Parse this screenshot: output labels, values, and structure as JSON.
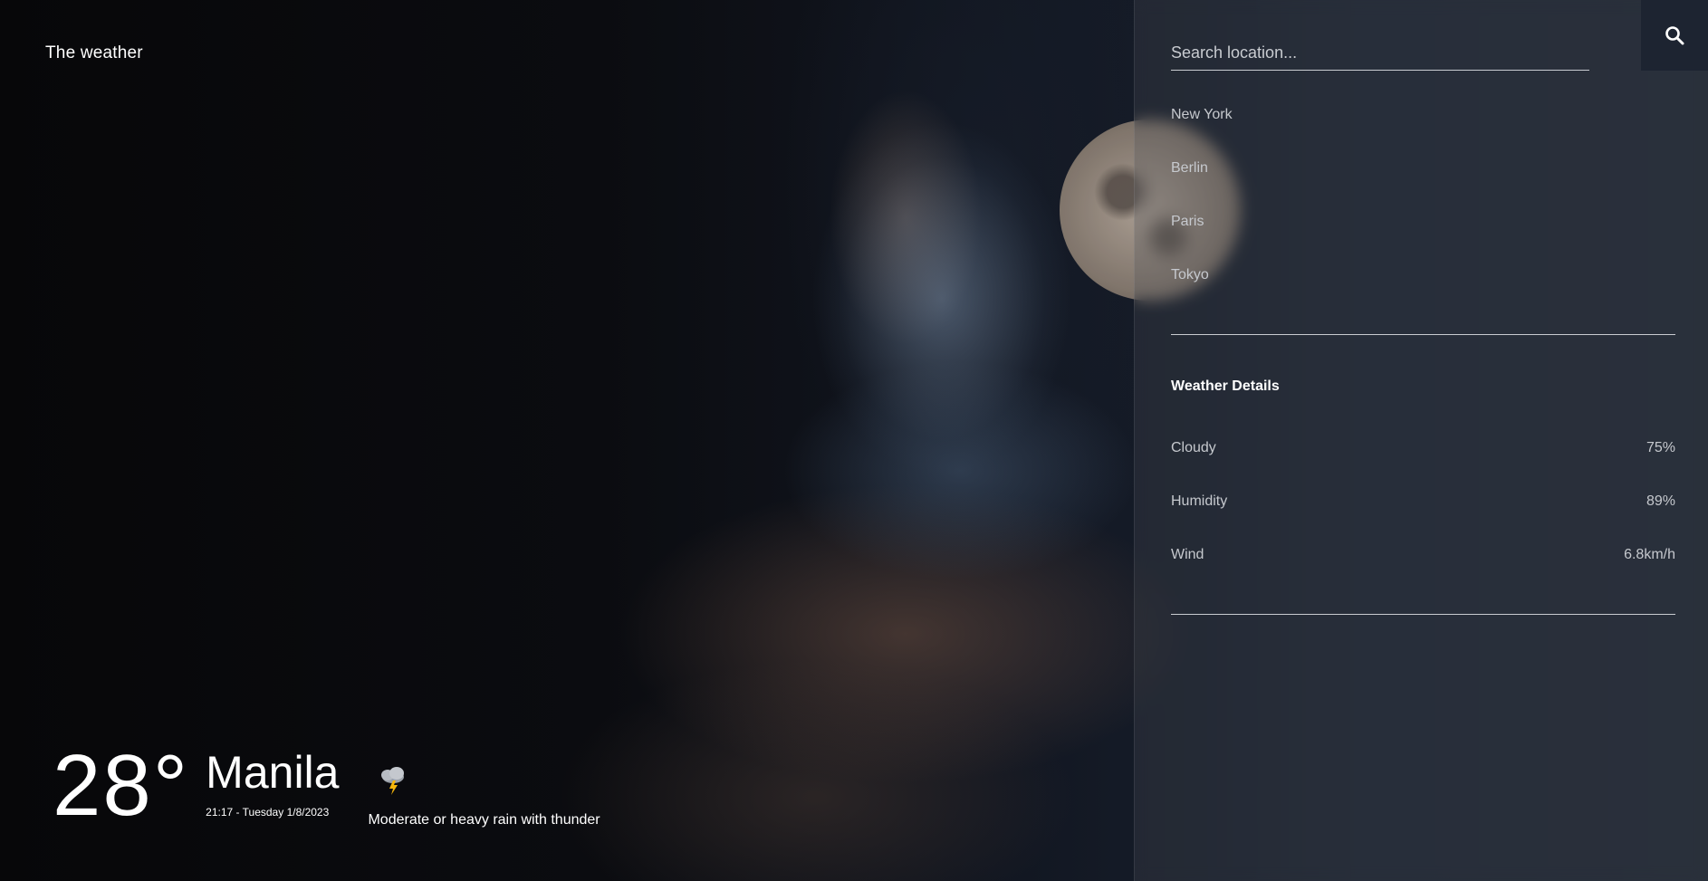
{
  "app": {
    "logo": "The weather"
  },
  "current": {
    "temperature": "28°",
    "city": "Manila",
    "datetime": "21:17 - Tuesday 1/8/2023",
    "condition": "Moderate or heavy rain with thunder",
    "condition_icon": "thunderstorm-icon"
  },
  "search": {
    "placeholder": "Search location...",
    "value": ""
  },
  "locations": [
    "New York",
    "Berlin",
    "Paris",
    "Tokyo"
  ],
  "details": {
    "title": "Weather Details",
    "rows": [
      {
        "label": "Cloudy",
        "value": "75%"
      },
      {
        "label": "Humidity",
        "value": "89%"
      },
      {
        "label": "Wind",
        "value": "6.8km/h"
      }
    ]
  },
  "colors": {
    "accent_button": "#1d2431",
    "text": "#ffffff",
    "muted": "#c6c9ce"
  }
}
